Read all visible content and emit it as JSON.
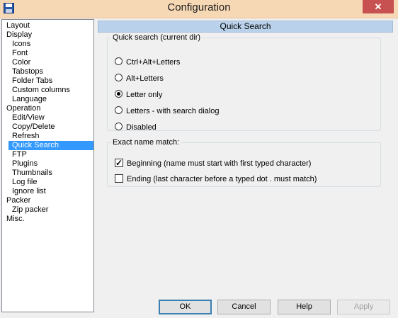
{
  "window": {
    "title": "Configuration",
    "close_glyph": "✕",
    "icon": "floppy-disk-icon"
  },
  "tree": {
    "items": [
      {
        "label": "Layout",
        "level": 0
      },
      {
        "label": "Display",
        "level": 0
      },
      {
        "label": "Icons",
        "level": 1
      },
      {
        "label": "Font",
        "level": 1
      },
      {
        "label": "Color",
        "level": 1
      },
      {
        "label": "Tabstops",
        "level": 1
      },
      {
        "label": "Folder Tabs",
        "level": 1
      },
      {
        "label": "Custom columns",
        "level": 1
      },
      {
        "label": "Language",
        "level": 1
      },
      {
        "label": "Operation",
        "level": 0
      },
      {
        "label": "Edit/View",
        "level": 1
      },
      {
        "label": "Copy/Delete",
        "level": 1
      },
      {
        "label": "Refresh",
        "level": 1
      },
      {
        "label": "Quick Search",
        "level": 1,
        "selected": true
      },
      {
        "label": "FTP",
        "level": 1
      },
      {
        "label": "Plugins",
        "level": 1
      },
      {
        "label": "Thumbnails",
        "level": 1
      },
      {
        "label": "Log file",
        "level": 1
      },
      {
        "label": "Ignore list",
        "level": 1
      },
      {
        "label": "Packer",
        "level": 0
      },
      {
        "label": "Zip packer",
        "level": 1
      },
      {
        "label": "Misc.",
        "level": 0
      }
    ]
  },
  "panel": {
    "header": "Quick Search",
    "quick_search": {
      "legend": "Quick search (current dir)",
      "options": [
        {
          "label": "Ctrl+Alt+Letters",
          "checked": false
        },
        {
          "label": "Alt+Letters",
          "checked": false
        },
        {
          "label": "Letter only",
          "checked": true
        },
        {
          "label": "Letters - with search dialog",
          "checked": false
        },
        {
          "label": "Disabled",
          "checked": false
        }
      ]
    },
    "exact_match": {
      "legend": "Exact name match:",
      "beginning": {
        "label": "Beginning (name must start with first typed character)",
        "checked": true
      },
      "ending": {
        "label": "Ending (last character before a typed dot . must match)",
        "checked": false
      }
    }
  },
  "buttons": {
    "ok": "OK",
    "cancel": "Cancel",
    "help": "Help",
    "apply": "Apply"
  },
  "colors": {
    "selection": "#3399ff",
    "header_bg": "#b9d1ea",
    "titlebar_bg": "#f7d8b5",
    "close_bg": "#c75050"
  }
}
